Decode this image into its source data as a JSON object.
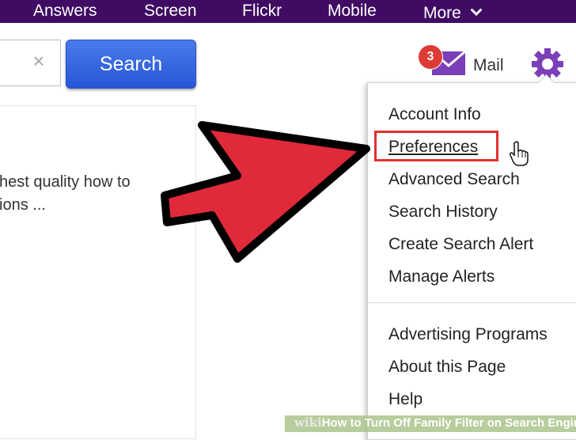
{
  "topnav": {
    "items": [
      "Answers",
      "Screen",
      "Flickr",
      "Mobile"
    ],
    "more_label": "More",
    "background": "#3f0b63"
  },
  "search": {
    "button_label": "Search",
    "clear_icon": "close-icon"
  },
  "results": {
    "snippet_lines": [
      "hest quality how to",
      "ions ..."
    ]
  },
  "header_right": {
    "mail_badge": "3",
    "mail_label": "Mail",
    "mail_icon": "envelope-icon",
    "settings_icon": "gear-icon",
    "accent": "#7b3fb8"
  },
  "settings_menu": {
    "items": [
      "Account Info",
      "Preferences",
      "Advanced Search",
      "Search History",
      "Create Search Alert",
      "Manage Alerts",
      "Advertising Programs",
      "About this Page",
      "Help"
    ],
    "highlighted": "Preferences",
    "highlight_color": "#e2302f"
  },
  "overlay": {
    "pointer_icon": "big-red-arrow",
    "cursor_icon": "hand-pointer-icon"
  },
  "footer": {
    "wiki": "wiki",
    "how": "How",
    "title": " to Turn Off Family Filter on Search Engines"
  }
}
